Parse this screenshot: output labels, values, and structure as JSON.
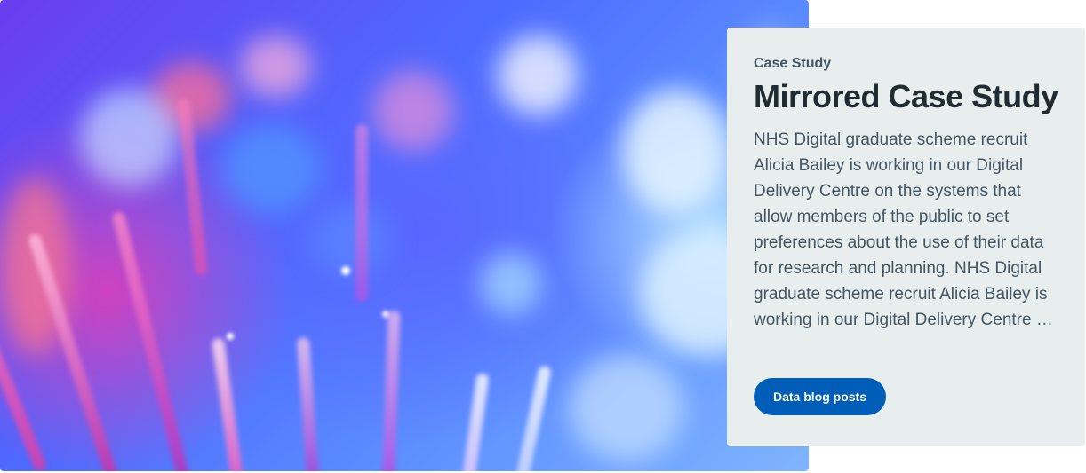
{
  "hero": {
    "image_name": "fibre-optic-lights-image"
  },
  "card": {
    "eyebrow": "Case Study",
    "title": "Mirrored Case Study",
    "body": "NHS Digital graduate scheme recruit Alicia Bailey is working in our Digital Delivery Centre on the systems that allow members of the public to set preferences about the use of their data for research and planning. NHS Digital graduate scheme recruit Alicia Bailey is working in our Digital Delivery Centre on the systems that allow members of…",
    "button_label": "Data blog posts"
  },
  "colors": {
    "card_background": "#e8edee",
    "button_background": "#005eb8",
    "title_text": "#212b32",
    "body_text": "#425563"
  }
}
